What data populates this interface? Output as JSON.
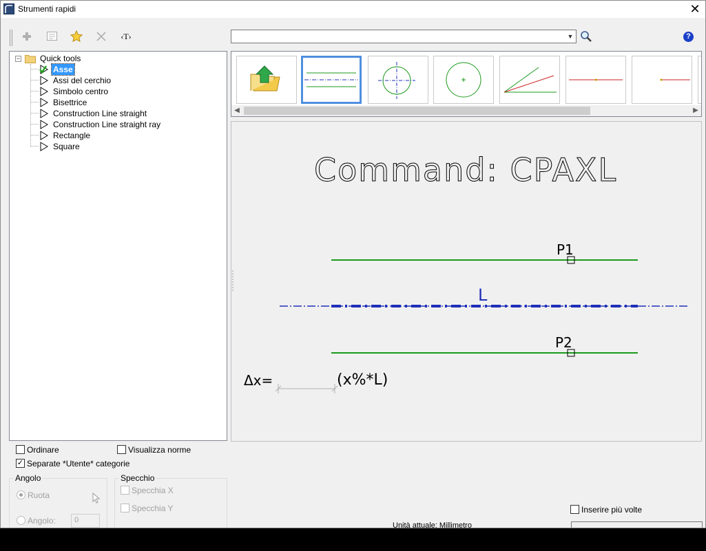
{
  "window": {
    "title": "Strumenti rapidi"
  },
  "toolbar": {
    "add_icon": "plus-icon",
    "properties_icon": "properties-icon",
    "favorite_icon": "star-icon",
    "delete_icon": "cross-icon",
    "text_label": "‹T›"
  },
  "search": {
    "value": "",
    "placeholder": ""
  },
  "tree": {
    "root": "Quick tools",
    "items": [
      {
        "label": "Asse",
        "selected": true
      },
      {
        "label": "Assi del cerchio"
      },
      {
        "label": "Simbolo centro"
      },
      {
        "label": "Bisettrice"
      },
      {
        "label": "Construction Line straight"
      },
      {
        "label": "Construction Line straight ray"
      },
      {
        "label": "Rectangle"
      },
      {
        "label": "Square"
      }
    ]
  },
  "thumbnails": [
    "folder-up",
    "axis",
    "circle-axes",
    "center-symbol",
    "bisector",
    "construction-line",
    "construction-ray"
  ],
  "preview": {
    "command": "Command:  CPAXL",
    "p1": "P1",
    "p2": "P2",
    "l": "L",
    "formula_left": "Δx=",
    "formula_right": "(x%*L)"
  },
  "options": {
    "ordinare": "Ordinare",
    "visualizza_norme": "Visualizza norme",
    "separate": "Separate *Utente* categorie",
    "separate_checked": true
  },
  "angolo": {
    "title": "Angolo",
    "ruota": "Ruota",
    "angolo_label": "Angolo:",
    "angolo_value": "0"
  },
  "specchio": {
    "title": "Specchio",
    "x": "Specchia X",
    "y": "Specchia Y"
  },
  "inserire": "Inserire più volte",
  "unit": "Unità attuale: Millimetro",
  "colors": {
    "selection": "#3399ff",
    "green_line": "#1a9a1a",
    "blue_line": "#1f2fb8",
    "help": "#1a3fc9"
  }
}
